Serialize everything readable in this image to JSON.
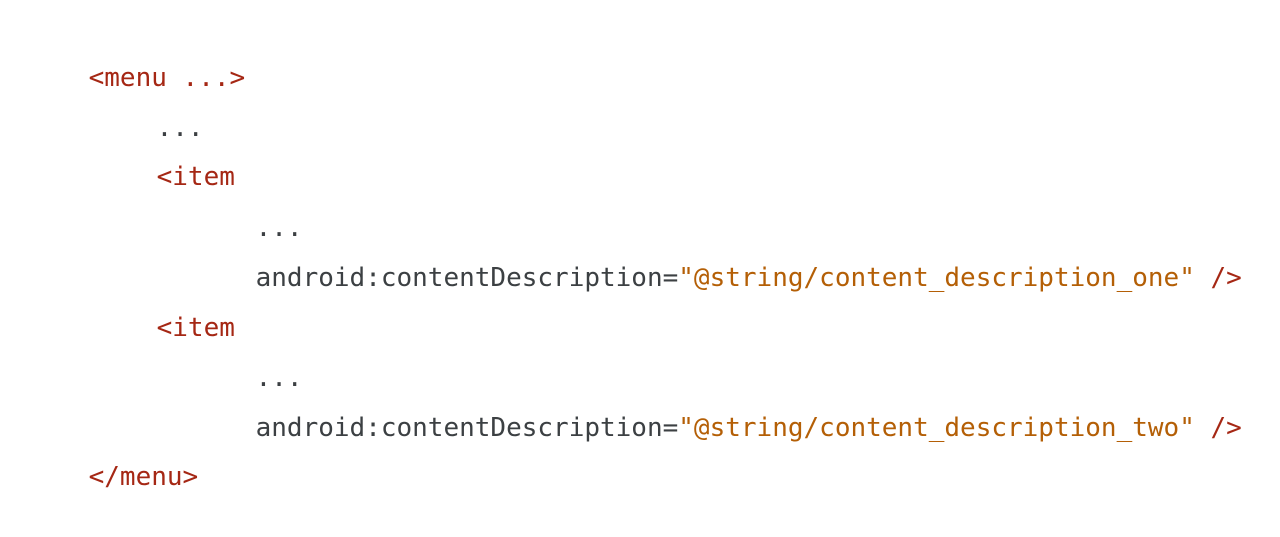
{
  "code": {
    "menu_open": "<menu ...>",
    "ellipsis_1": "...",
    "item_1": {
      "open": "<item",
      "ellipsis": "...",
      "attr_name": "android:contentDescription",
      "equals": "=",
      "attr_value": "\"@string/content_description_one\"",
      "close": " />"
    },
    "item_2": {
      "open": "<item",
      "ellipsis": "...",
      "attr_name": "android:contentDescription",
      "equals": "=",
      "attr_value": "\"@string/content_description_two\"",
      "close": " />"
    },
    "menu_close": "</menu>"
  },
  "colors": {
    "tag": "#a52714",
    "attribute": "#3c4043",
    "string": "#b45f06",
    "background": "#ffffff"
  }
}
